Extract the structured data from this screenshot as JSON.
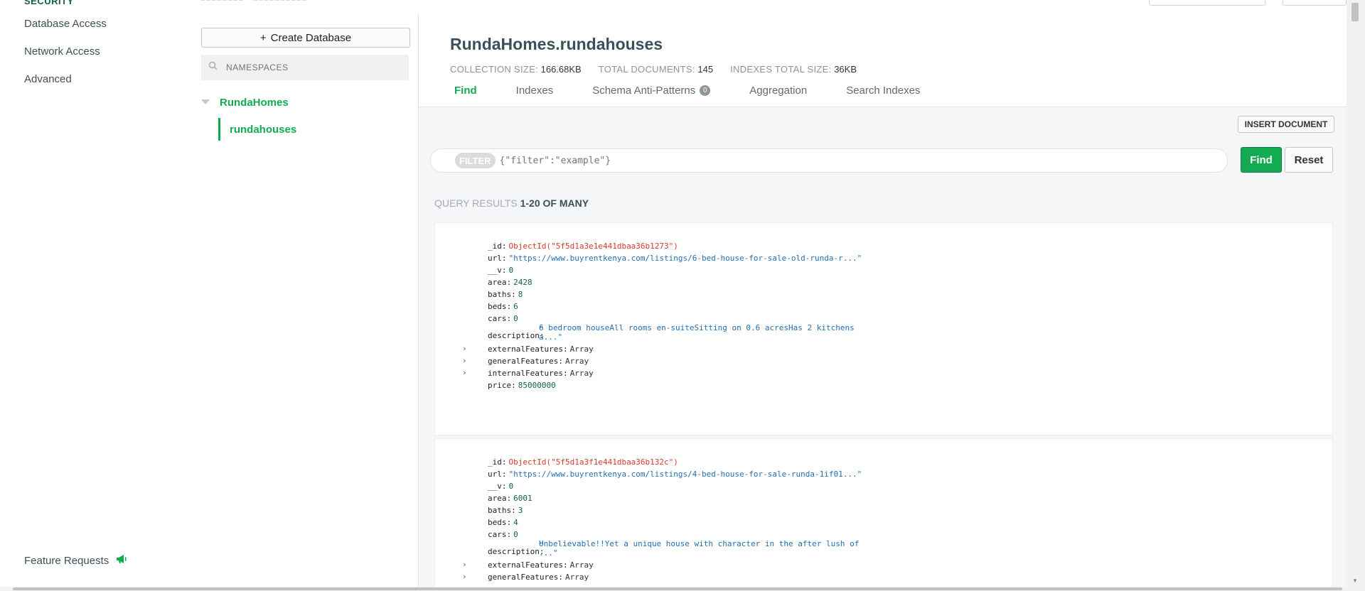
{
  "left_nav": {
    "section_label": "SECURITY",
    "items": [
      {
        "label": "Database Access"
      },
      {
        "label": "Network Access"
      },
      {
        "label": "Advanced"
      }
    ],
    "feature_requests": "Feature Requests"
  },
  "sidebar": {
    "create_database": "Create Database",
    "search_placeholder": "NAMESPACES",
    "database": "RundaHomes",
    "collection": "rundahouses"
  },
  "main": {
    "title": "RundaHomes.rundahouses",
    "stats": [
      {
        "label": "COLLECTION SIZE:",
        "value": "166.68KB"
      },
      {
        "label": "TOTAL DOCUMENTS:",
        "value": "145"
      },
      {
        "label": "INDEXES TOTAL SIZE:",
        "value": "36KB"
      }
    ],
    "tabs": [
      {
        "label": "Find",
        "active": true
      },
      {
        "label": "Indexes"
      },
      {
        "label": "Schema Anti-Patterns",
        "badge": "0"
      },
      {
        "label": "Aggregation"
      },
      {
        "label": "Search Indexes"
      }
    ],
    "insert_document": "INSERT DOCUMENT",
    "filter": {
      "pill": "FILTER",
      "placeholder": "{\"filter\":\"example\"}",
      "find": "Find",
      "reset": "Reset"
    },
    "query_results": {
      "label": "QUERY RESULTS",
      "range": "1-20 OF MANY"
    },
    "documents": [
      {
        "_id": "ObjectId(\"5f5d1a3e1e441dbaa36b1273\")",
        "url": "\"https://www.buyrentkenya.com/listings/6-bed-house-for-sale-old-runda-r...\"",
        "__v": "0",
        "area": "2428",
        "baths": "8",
        "beds": "6",
        "cars": "0",
        "description": "6 bedroom houseAll rooms en-suiteSitting on 0.6 acresHas 2 kitchens a...\"",
        "externalFeatures": "Array",
        "generalFeatures": "Array",
        "internalFeatures": "Array",
        "price": "85000000"
      },
      {
        "_id": "ObjectId(\"5f5d1a3f1e441dbaa36b132c\")",
        "url": "\"https://www.buyrentkenya.com/listings/4-bed-house-for-sale-runda-1if01...\"",
        "__v": "0",
        "area": "6001",
        "baths": "3",
        "beds": "4",
        "cars": "0",
        "description": "Unbelievable!!Yet a unique house with character in the after lush of ...\"",
        "externalFeatures": "Array",
        "generalFeatures": "Array"
      }
    ]
  },
  "colors": {
    "accent_green": "#13aa52",
    "dark_green": "#116149",
    "objectid_red": "#d5392d",
    "string_blue": "#1f6fb5"
  }
}
